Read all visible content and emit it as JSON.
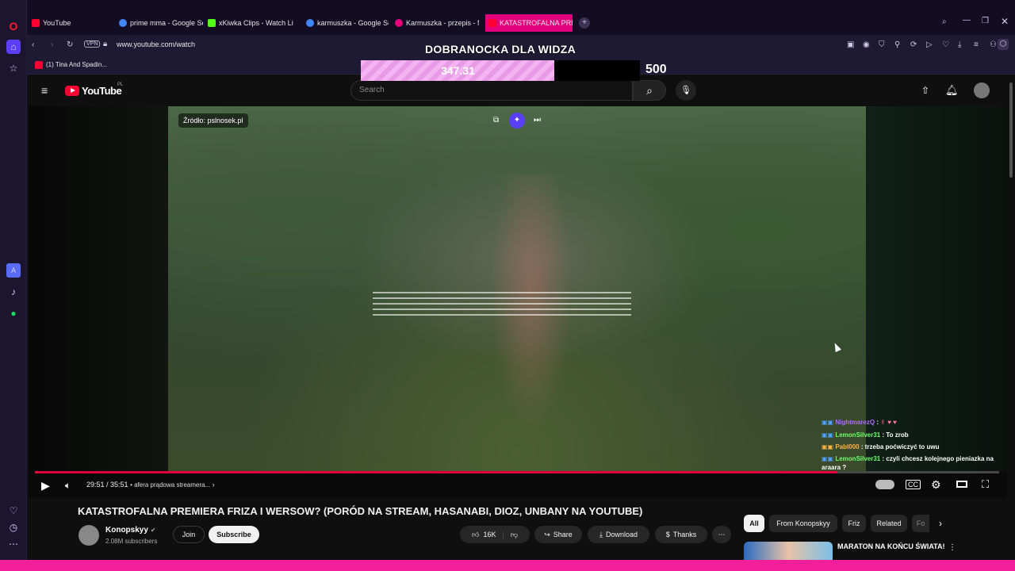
{
  "browser": {
    "tabs": [
      {
        "label": "YouTube",
        "color": "#ff0033"
      },
      {
        "label": "prime mma - Google Sear",
        "color": "#4285f4"
      },
      {
        "label": "xKiwka Clips - Watch Live",
        "color": "#53fc18"
      },
      {
        "label": "karmuszka - Google Sear",
        "color": "#4285f4"
      },
      {
        "label": "Karmuszka - przepis - Mo",
        "color": "#e4007c"
      },
      {
        "label": "KATASTROFALNA PREMIE",
        "color": "#ff0033"
      }
    ],
    "url": "www.youtube.com/watch",
    "vpn_label": "VPN",
    "bookmark_label": "(1) Tina And Spadin..."
  },
  "overlay": {
    "title": "DOBRANOCKA DLA WIDZA",
    "current": "347.31",
    "goal": "500",
    "progress_fraction": 0.6946
  },
  "youtube": {
    "logo_text": "YouTube",
    "region": "PL",
    "search_placeholder": "Search"
  },
  "player": {
    "source_badge": "Źródło: pslnosek.pl",
    "time": "29:51 / 35:51",
    "chapter": "• afera prądowa streamera...",
    "progress_fraction": 0.832
  },
  "chat": [
    {
      "user": "NightmarezQ",
      "text": ":",
      "user_color": "#b06bff"
    },
    {
      "user": "LemonSilver31",
      "text": ": To zrob",
      "user_color": "#6cff6c"
    },
    {
      "user": "Pabl000",
      "text": ": trzeba poćwiczyć to uwu",
      "user_color": "#ffb347"
    },
    {
      "user": "LemonSilver31",
      "text": ": czyli chcesz kolejnego pieniazka na araara ?",
      "user_color": "#6cff6c"
    }
  ],
  "video": {
    "title": "KATASTROFALNA PREMIERA FRIZA I WERSOW? (PORÓD NA STREAM, HASANABI, DIOZ, UNBANY NA YOUTUBE)",
    "channel": "Konopskyy",
    "subscribers": "2.08M subscribers",
    "join_label": "Join",
    "subscribe_label": "Subscribe",
    "likes": "16K",
    "share_label": "Share",
    "download_label": "Download",
    "thanks_label": "Thanks"
  },
  "sidebar_chips": [
    "All",
    "From Konopskyy",
    "Friz",
    "Related",
    "Fo"
  ],
  "related": {
    "title": "MARATON NA KOŃCU ŚWIATA!"
  }
}
